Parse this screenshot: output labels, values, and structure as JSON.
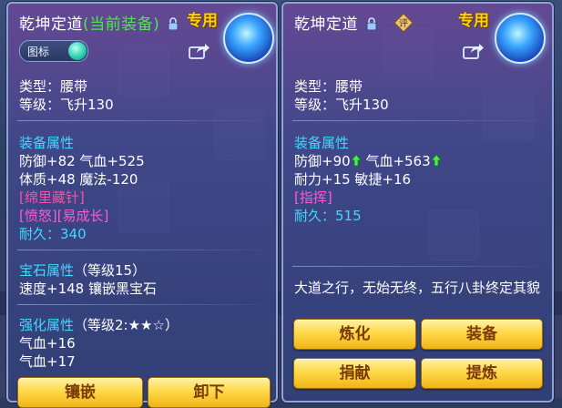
{
  "left": {
    "title": "乾坤定道",
    "current_tag": "(当前装备)",
    "exclusive": "专用",
    "toggle_label": "图标",
    "type_line": "类型：腰带",
    "level_line": "等级：飞升130",
    "attr_header": "装备属性",
    "attr_line1": "防御+82 气血+525",
    "attr_line2": "体质+48 魔法-120",
    "special1": "[绵里藏针]",
    "special2": "[愤怒][易成长]",
    "durability": "耐久：340",
    "gem_header": "宝石属性",
    "gem_level": "（等级15）",
    "gem_line": "速度+148 镶嵌黑宝石",
    "enh_header": "强化属性",
    "enh_level": "（等级2:★★☆）",
    "enh_line1": "气血+16",
    "enh_line2": "气血+17",
    "btn_inlay": "镶嵌",
    "btn_unequip": "卸下"
  },
  "right": {
    "title": "乾坤定道",
    "appraise_glyph": "评",
    "exclusive": "专用",
    "type_line": "类型：腰带",
    "level_line": "等级：飞升130",
    "attr_header": "装备属性",
    "attr_def": "防御+90",
    "attr_hp": "气血+563",
    "attr_line2": "耐力+15 敏捷+16",
    "special1": "[指挥]",
    "durability": "耐久：515",
    "desc": "大道之行，无始无终，五行八卦终定其貌",
    "btn_refine": "炼化",
    "btn_equip": "装备",
    "btn_donate": "捐献",
    "btn_extract": "提炼"
  },
  "icons": [
    "lock-icon",
    "share-icon",
    "emblem-icon",
    "toggle-knob",
    "appraise-icon",
    "up-arrow-icon"
  ],
  "colors": {
    "green": "#4cf04c",
    "cyan": "#41d9ff",
    "pink": "#ff4da6",
    "gold": "#ffd400",
    "button": "#ffd84a"
  }
}
